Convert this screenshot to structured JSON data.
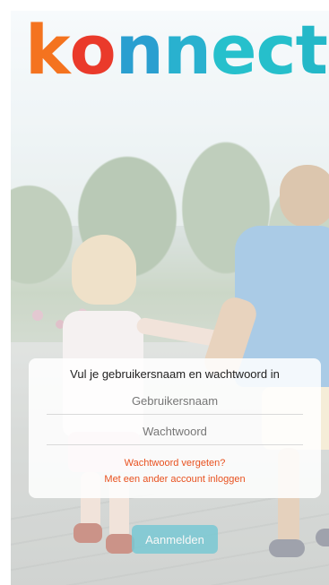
{
  "logo": {
    "letters": [
      "k",
      "o",
      "n",
      "n",
      "e",
      "c",
      "t"
    ],
    "colors": [
      "#f4731f",
      "#ea3a2b",
      "#2a9fd0",
      "#29b1cf",
      "#26c0cc",
      "#26bfcb",
      "#24b8c8"
    ]
  },
  "login": {
    "prompt": "Vul je gebruikersnaam en wachtwoord in",
    "username_placeholder": "Gebruikersnaam",
    "password_placeholder": "Wachtwoord",
    "forgot_password_link": "Wachtwoord vergeten?",
    "other_account_link": "Met een ander account inloggen",
    "submit_label": "Aanmelden"
  },
  "colors": {
    "accent_link": "#e8511f",
    "button_bg": "#79c9d4"
  }
}
